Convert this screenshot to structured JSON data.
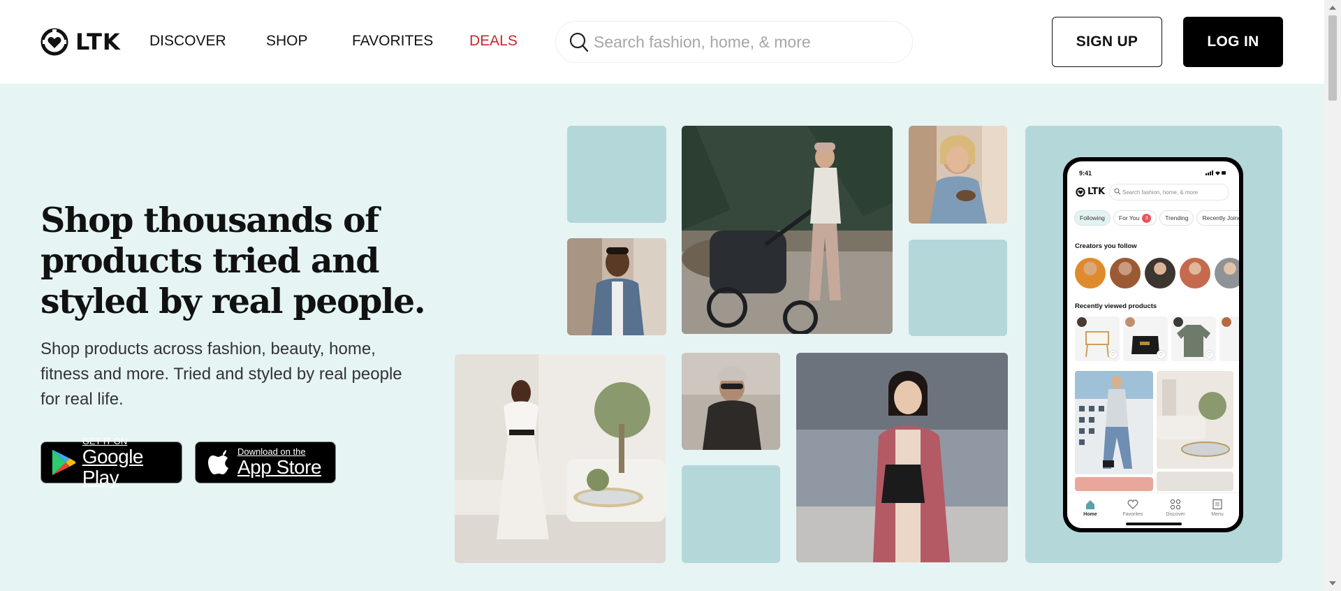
{
  "header": {
    "logo_text": "LTK",
    "nav": [
      {
        "label": "DISCOVER"
      },
      {
        "label": "SHOP"
      },
      {
        "label": "FAVORITES"
      },
      {
        "label": "DEALS"
      }
    ],
    "search_placeholder": "Search fashion, home, & more",
    "signup_label": "SIGN UP",
    "login_label": "LOG IN",
    "deals_color": "#c8262e"
  },
  "hero": {
    "headline": "Shop thousands of products tried and styled by real people.",
    "subtext": "Shop products across fashion, beauty, home, fitness and more. Tried and styled by real people for real life.",
    "google_play": {
      "small": "GET IT ON",
      "big": "Google Play"
    },
    "app_store": {
      "small": "Download on the",
      "big": "App Store"
    },
    "background_color": "#e7f4f4",
    "tile_color": "#b4d7da"
  },
  "phone": {
    "time": "9:41",
    "logo_text": "LTK",
    "search_placeholder": "Search fashion, home, & more",
    "chips": [
      {
        "label": "Following",
        "active": true
      },
      {
        "label": "For You",
        "badge": "3"
      },
      {
        "label": "Trending"
      },
      {
        "label": "Recently Joined"
      }
    ],
    "creators_title": "Creators you follow",
    "recent_title": "Recently viewed products",
    "tabs": [
      {
        "label": "Home",
        "icon": "home-icon"
      },
      {
        "label": "Favorites",
        "icon": "heart-icon"
      },
      {
        "label": "Discover",
        "icon": "grid-icon"
      },
      {
        "label": "Menu",
        "icon": "menu-icon"
      }
    ]
  }
}
